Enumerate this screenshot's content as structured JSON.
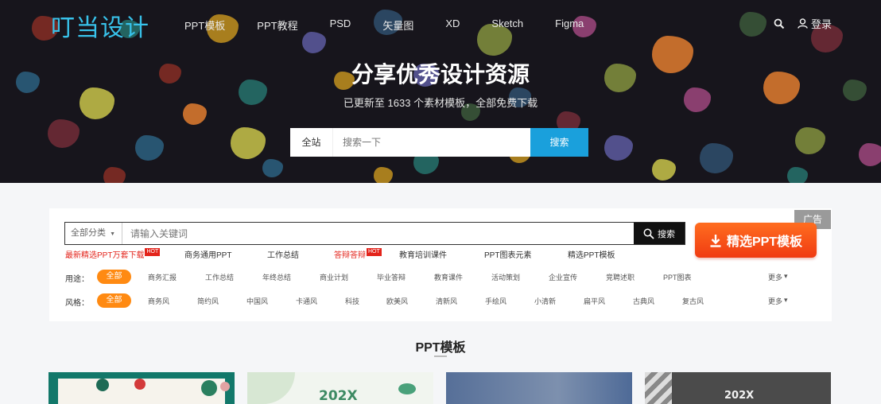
{
  "nav": {
    "logo": "叮当设计",
    "links": [
      "PPT模板",
      "PPT教程",
      "PSD",
      "矢量图",
      "XD",
      "Sketch",
      "Figma"
    ],
    "login_label": "登录",
    "icons": {
      "search": "search-icon",
      "user": "user-icon"
    }
  },
  "hero": {
    "title": "分享优秀设计资源",
    "subtitle": "已更新至 1633 个素材模板，全部免费下载",
    "search": {
      "scope": "全站",
      "placeholder": "搜索一下",
      "button": "搜索"
    }
  },
  "ad": {
    "label": "广告"
  },
  "search": {
    "scope": "全部分类",
    "placeholder": "请输入关键词",
    "button": "搜索",
    "featured_label": "精选PPT模板"
  },
  "hot_links": [
    {
      "label": "最新精选PPT万套下载",
      "highlight": true,
      "badge": "HOT"
    },
    {
      "label": "商务通用PPT",
      "highlight": false,
      "badge": ""
    },
    {
      "label": "工作总结",
      "highlight": false,
      "badge": ""
    },
    {
      "label": "答辩答辩",
      "highlight": true,
      "badge": "HOT"
    },
    {
      "label": "教育培训课件",
      "highlight": false,
      "badge": ""
    },
    {
      "label": "PPT图表元素",
      "highlight": false,
      "badge": ""
    },
    {
      "label": "精选PPT模板",
      "highlight": false,
      "badge": ""
    }
  ],
  "filters": {
    "use": {
      "label": "用途：",
      "all": "全部",
      "items": [
        "商务汇报",
        "工作总结",
        "年终总结",
        "商业计划",
        "毕业答辩",
        "教育课件",
        "活动策划",
        "企业宣传",
        "竞聘述职",
        "PPT图表"
      ],
      "more": "更多"
    },
    "style": {
      "label": "风格：",
      "all": "全部",
      "items": [
        "商务风",
        "简约风",
        "中国风",
        "卡通风",
        "科技",
        "欧美风",
        "清新风",
        "手绘风",
        "小清新",
        "扁平风",
        "古典风",
        "复古风"
      ],
      "more": "更多"
    }
  },
  "section": {
    "title": "PPT模板"
  },
  "cards": [
    {
      "name": "floral-template",
      "text": ""
    },
    {
      "name": "green-2020-template",
      "text": "202X"
    },
    {
      "name": "blue-business-template",
      "text": ""
    },
    {
      "name": "geometric-2020-template",
      "text": "202X"
    }
  ],
  "colors": {
    "brand": "#38c2ea",
    "hero_bg": "#17151c",
    "search_button": "#1aa0dc",
    "featured_button": "#f03b12",
    "filter_pill": "#ff8a12",
    "highlight": "#e3241b"
  }
}
